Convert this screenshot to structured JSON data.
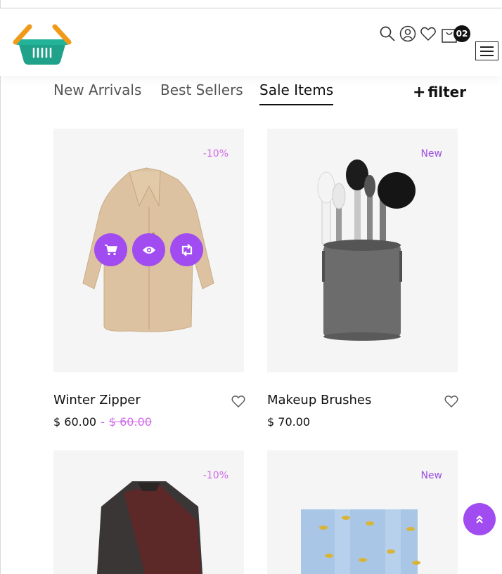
{
  "header": {
    "cart_count": "02",
    "icons": [
      "search-icon",
      "user-icon",
      "heart-icon",
      "cart-icon",
      "menu-icon"
    ],
    "logo": "basket-logo"
  },
  "tabs": [
    {
      "label": "New Arrivals",
      "active": false
    },
    {
      "label": "Best Sellers",
      "active": false
    },
    {
      "label": "Sale Items",
      "active": true
    }
  ],
  "filter": {
    "label": "filter"
  },
  "products": [
    {
      "name": "Winter Zipper",
      "price": "$ 60.00",
      "sep": "-",
      "old_price": "$ 60.00",
      "badge": "-10%",
      "image": "beige-coat"
    },
    {
      "name": "Makeup Brushes",
      "price": "$ 70.00",
      "badge": "New",
      "image": "brush-holder"
    },
    {
      "badge": "-10%",
      "image": "knit-poncho"
    },
    {
      "badge": "New",
      "image": "denim-tote"
    }
  ],
  "colors": {
    "accent": "#a14cf0",
    "sale": "#d06be8",
    "new": "#9c4fe0",
    "card_bg": "#f5f5f5"
  },
  "scroll_top": {
    "icon": "double-chevron-up-icon"
  }
}
